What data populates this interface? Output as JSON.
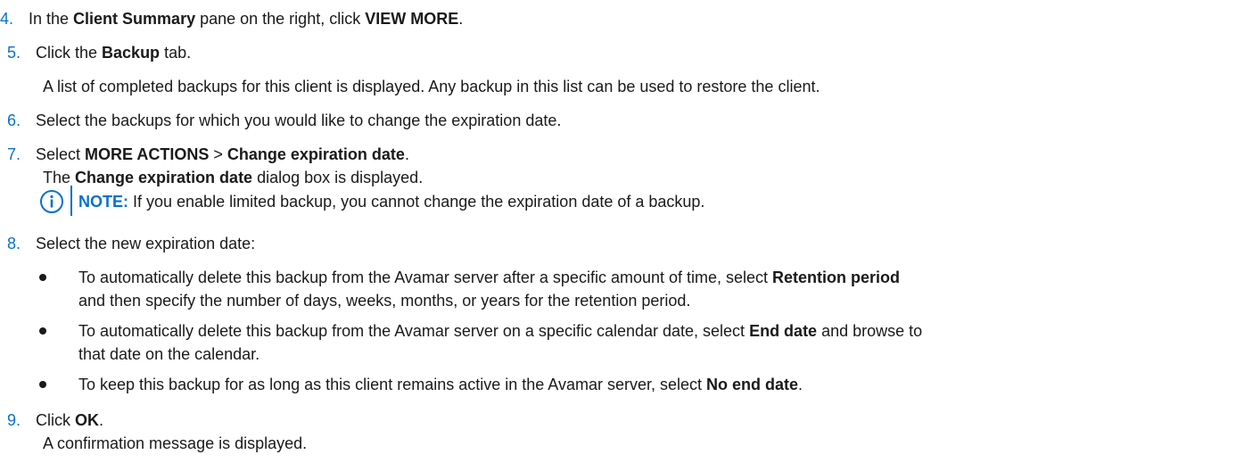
{
  "steps": [
    {
      "num": "4.",
      "parts": [
        "In the ",
        "Client Summary",
        " pane on the right, click ",
        "VIEW MORE",
        "."
      ]
    },
    {
      "num": "5.",
      "parts": [
        "Click the ",
        "Backup",
        " tab."
      ]
    },
    {
      "text_line": "A list of completed backups for this client is displayed. Any backup in this list can be used to restore the client."
    },
    {
      "num": "6.",
      "text": "Select the backups for which you would like to change the expiration date."
    },
    {
      "num": "7.",
      "parts": [
        "Select ",
        "MORE ACTIONS",
        " > ",
        "Change expiration date",
        "."
      ]
    },
    {
      "parts2": [
        "The ",
        "Change expiration date",
        " dialog box is displayed."
      ]
    },
    {
      "note": {
        "label": "NOTE:",
        "text": " If you enable limited backup, you cannot change the expiration date of a backup."
      }
    },
    {
      "num": "8.",
      "text": "Select the new expiration date:"
    },
    {
      "bullets": [
        {
          "line1": [
            "To automatically delete this backup from the Avamar server after a specific amount of time, select ",
            "Retention period"
          ],
          "line2": "and then specify the number of days, weeks, months, or years for the retention period."
        },
        {
          "line1": [
            "To automatically delete this backup from the Avamar server on a specific calendar date, select ",
            "End date",
            " and browse to"
          ],
          "line2": "that date on the calendar."
        },
        {
          "line1": [
            "To keep this backup for as long as this client remains active in the Avamar server, select ",
            "No end date",
            "."
          ]
        }
      ]
    },
    {
      "num": "9.",
      "parts": [
        "Click ",
        "OK",
        "."
      ]
    },
    {
      "text_line": "A confirmation message is displayed."
    }
  ],
  "icons": {
    "note_icon": "info-circle-icon"
  },
  "colors": {
    "accent": "#0672cb",
    "text": "#1a1a1a"
  }
}
